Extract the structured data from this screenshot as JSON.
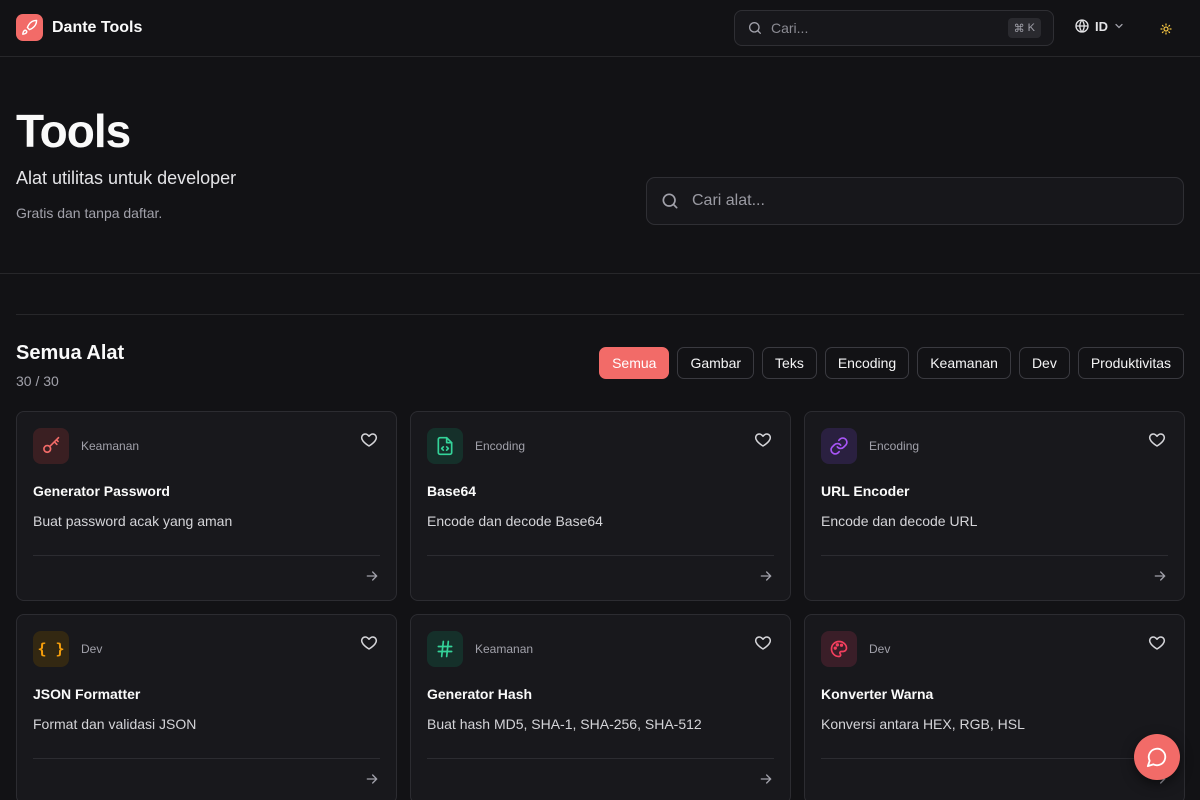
{
  "colors": {
    "accent": "#f26b68",
    "background": "#121215",
    "card": "#18181c"
  },
  "header": {
    "brand_name": "Dante Tools",
    "logo_icon": "rocket-icon",
    "search_placeholder": "Cari...",
    "shortcut_symbol": "⌘",
    "shortcut_key": "K",
    "language": "ID",
    "theme_icon": "sun-icon"
  },
  "hero": {
    "title": "Tools",
    "subtitle": "Alat utilitas untuk developer",
    "note": "Gratis dan tanpa daftar.",
    "search_placeholder": "Cari alat..."
  },
  "section": {
    "title": "Semua Alat",
    "count": "30 / 30",
    "filters": [
      {
        "label": "Semua",
        "active": true
      },
      {
        "label": "Gambar",
        "active": false
      },
      {
        "label": "Teks",
        "active": false
      },
      {
        "label": "Encoding",
        "active": false
      },
      {
        "label": "Keamanan",
        "active": false
      },
      {
        "label": "Dev",
        "active": false
      },
      {
        "label": "Produktivitas",
        "active": false
      }
    ]
  },
  "tools": [
    {
      "category": "Keamanan",
      "title": "Generator Password",
      "description": "Buat password acak yang aman",
      "icon": "key-icon",
      "icon_color": "#f26b68"
    },
    {
      "category": "Encoding",
      "title": "Base64",
      "description": "Encode dan decode Base64",
      "icon": "file-code-icon",
      "icon_color": "#34d399"
    },
    {
      "category": "Encoding",
      "title": "URL Encoder",
      "description": "Encode dan decode URL",
      "icon": "link-icon",
      "icon_color": "#a855f7"
    },
    {
      "category": "Dev",
      "title": "JSON Formatter",
      "description": "Format dan validasi JSON",
      "icon": "braces-icon",
      "icon_color": "#f59e0b"
    },
    {
      "category": "Keamanan",
      "title": "Generator Hash",
      "description": "Buat hash MD5, SHA-1, SHA-256, SHA-512",
      "icon": "hash-icon",
      "icon_color": "#34d399"
    },
    {
      "category": "Dev",
      "title": "Konverter Warna",
      "description": "Konversi antara HEX, RGB, HSL",
      "icon": "palette-icon",
      "icon_color": "#f43f5e"
    }
  ],
  "chat_icon": "chat-bubble-icon"
}
